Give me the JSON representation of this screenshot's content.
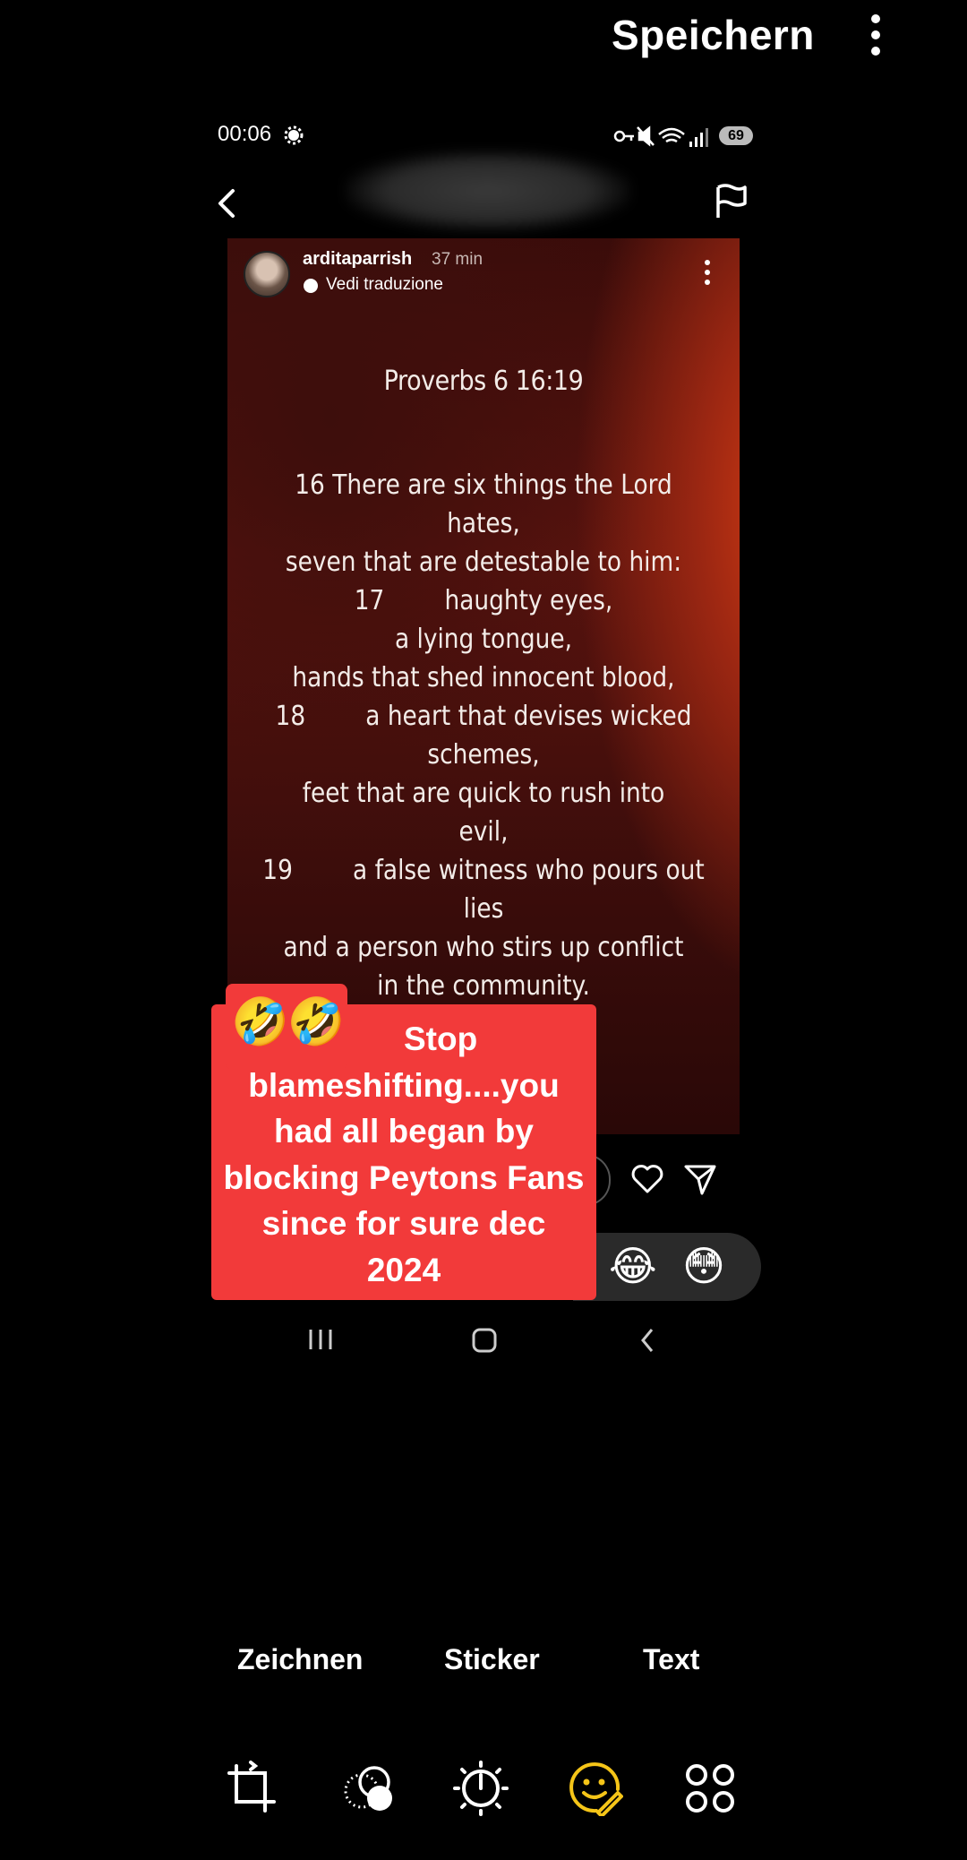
{
  "toolbar": {
    "save_label": "Speichern",
    "more_icon": "more-vert-icon"
  },
  "status_bar": {
    "time": "00:06",
    "battery": "69"
  },
  "story": {
    "username": "arditaparrish",
    "time_ago": "37 min",
    "translate_label": "Vedi traduzione",
    "verse_title": "Proverbs 6 16:19",
    "verse_lines": [
      "16 There are six things the Lord",
      "hates,",
      "seven that are detestable to him:",
      "17        haughty eyes,",
      "a lying tongue,",
      "hands that shed innocent blood,",
      "18        a heart that devises wicked",
      "schemes,",
      "feet that are quick to rush into",
      "evil,",
      "19        a false witness who pours out",
      "lies",
      "and a person who stirs up conflict",
      "in the community."
    ]
  },
  "reactions": {
    "laugh": "😂",
    "flushed": "😳"
  },
  "sticker": {
    "emojis": "🤣🤣",
    "text": "        Stop\nblameshifting....you\nhad all began by\nblocking Peytons Fans\nsince for sure dec\n2024",
    "background": "#f23a3a"
  },
  "modes": {
    "draw": "Zeichnen",
    "sticker": "Sticker",
    "text": "Text"
  },
  "tools": [
    "crop-rotate-icon",
    "filter-icon",
    "brightness-icon",
    "sticker-emoji-icon",
    "more-apps-icon"
  ],
  "colors": {
    "active_tool": "#f5c518"
  }
}
